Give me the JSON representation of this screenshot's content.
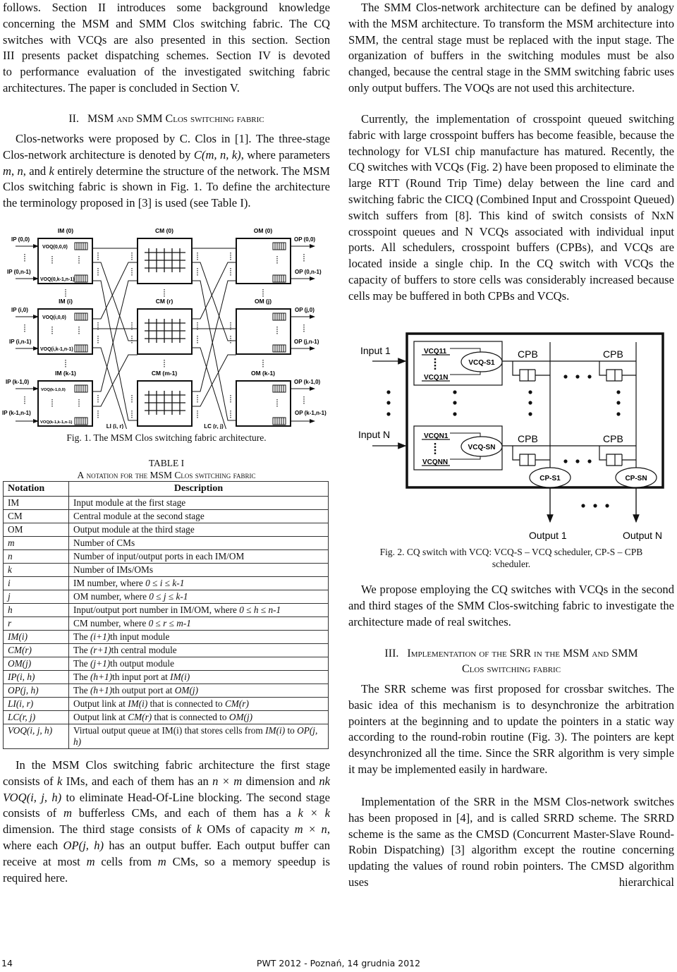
{
  "left_column": {
    "intro_paragraph": [
      "follows. Section II introduces some background knowledge",
      "concerning the MSM and SMM Clos switching fabric. The CQ",
      "switches with VCQs are also presented in this section. Section",
      "III presents packet dispatching schemes. Section IV is devoted",
      "to performance evaluation of the investigated switching fabric",
      "architectures. The paper is concluded in Section V."
    ],
    "section2_heading": {
      "number": "II.",
      "title_a": "MSM",
      "title_b": "and",
      "title_c": "SMM C",
      "title_d": "los switching fabric"
    },
    "section2_paragraph": {
      "t1": "Clos-networks were proposed by C. Clos in [1]. The three-stage Clos-network architecture is denoted by ",
      "i1": "C(m, n, k)",
      "t2": ", where parameters ",
      "i2": "m",
      "t3": ", ",
      "i3": "n",
      "t4": ", and ",
      "i4": "k",
      "t5": " entirely determine the structure of the network. The MSM Clos switching fabric is shown in Fig. 1. To define the architecture the terminology proposed in [3] is used (see Table I)."
    },
    "fig1": {
      "caption": "Fig. 1.  The MSM Clos switching fabric architecture.",
      "im_labels": [
        "IM (0)",
        "IM (i)",
        "IM (k-1)"
      ],
      "cm_labels": [
        "CM (0)",
        "CM (r)",
        "CM (m-1)"
      ],
      "om_labels": [
        "OM (0)",
        "OM (j)",
        "OM (k-1)"
      ],
      "ip_labels": [
        [
          "IP (0,0)",
          "IP (0,n-1)"
        ],
        [
          "IP (i,0)",
          "IP (i,n-1)"
        ],
        [
          "IP (k-1,0)",
          "IP (k-1,n-1)"
        ]
      ],
      "op_labels": [
        [
          "OP (0,0)",
          "OP (0,n-1)"
        ],
        [
          "OP (j,0)",
          "OP (j,n-1)"
        ],
        [
          "OP (k-1,0)",
          "OP (k-1,n-1)"
        ]
      ],
      "voq_labels": [
        [
          "VOQ(0,0,0)",
          "VOQ(0,k-1,n-1)"
        ],
        [
          "VOQ(i,0,0)",
          "VOQ(i,k-1,n-1)"
        ],
        [
          "VOQ(k-1,0,0)",
          "VOQ(k-1,k-1,n-1)"
        ]
      ],
      "link_labels": {
        "li": "LI (i, r)",
        "lc": "LC (r, j)"
      }
    },
    "table1": {
      "title": "TABLE I",
      "subtitle_a": "A",
      "subtitle_b": " notation for the ",
      "subtitle_c": "MSM C",
      "subtitle_d": "los switching fabric",
      "headers": [
        "Notation",
        "Description"
      ],
      "rows": [
        {
          "n": "IM",
          "n_italic": false,
          "d": "Input module at the first stage"
        },
        {
          "n": "CM",
          "n_italic": false,
          "d": "Central module at the second stage"
        },
        {
          "n": "OM",
          "n_italic": false,
          "d": "Output module at the third stage"
        },
        {
          "n": "m",
          "n_italic": true,
          "d": "Number of CMs"
        },
        {
          "n": "n",
          "n_italic": true,
          "d": "Number of input/output ports in each IM/OM"
        },
        {
          "n": "k",
          "n_italic": true,
          "d": "Number of IMs/OMs"
        },
        {
          "n": "i",
          "n_italic": true,
          "d": "IM number, where ",
          "d_i": "0 ≤ i ≤ k-1"
        },
        {
          "n": "j",
          "n_italic": true,
          "d": "OM number, where ",
          "d_i": "0 ≤ j ≤ k-1"
        },
        {
          "n": "h",
          "n_italic": true,
          "d": "Input/output port number in IM/OM, where ",
          "d_i": "0 ≤ h ≤ n-1"
        },
        {
          "n": "r",
          "n_italic": true,
          "d": "CM number, where ",
          "d_i": "0 ≤ r ≤ m-1"
        },
        {
          "n": "IM(i)",
          "n_italic": true,
          "d": "The ",
          "d_i": "(i+1)",
          "d2": "th input module"
        },
        {
          "n": "CM(r)",
          "n_italic": true,
          "d": "The ",
          "d_i": "(r+1)",
          "d2": "th central module"
        },
        {
          "n": "OM(j)",
          "n_italic": true,
          "d": "The ",
          "d_i": "(j+1)",
          "d2": "th output module"
        },
        {
          "n": "IP(i, h)",
          "n_italic": true,
          "d": "The ",
          "d_i": "(h+1)",
          "d2": "th input port at ",
          "d_i2": "IM(i)"
        },
        {
          "n": "OP(j, h)",
          "n_italic": true,
          "d": "The ",
          "d_i": "(h+1)",
          "d2": "th output port at ",
          "d_i2": "OM(j)"
        },
        {
          "n": "LI(i, r)",
          "n_italic": true,
          "d": "Output link at ",
          "d_i": "IM(i)",
          "d2": " that is connected to ",
          "d_i2": "CM(r)"
        },
        {
          "n": "LC(r, j)",
          "n_italic": true,
          "d": "Output link at ",
          "d_i": "CM(r)",
          "d2": " that is connected to ",
          "d_i2": "OM(j)"
        },
        {
          "n": "VOQ(i, j, h)",
          "n_italic": true,
          "d": "Virtual output queue at IM(i) that stores cells from ",
          "d_i": "IM(i)",
          "d2": " to ",
          "d_i2": "OP(j, h)"
        }
      ]
    },
    "msm_paragraph": {
      "t1": "In the MSM Clos switching fabric architecture the first stage consists of ",
      "i1": "k",
      "t2": " IMs, and each of them has an ",
      "i2": "n × m",
      "t3": " dimension and ",
      "i3": "nk VOQ(i, j, h)",
      "t4": " to eliminate Head-Of-Line blocking. The second stage consists of ",
      "i4": "m",
      "t5": " bufferless CMs, and each of them has a ",
      "i5": "k × k",
      "t6": " dimension. The third stage consists of ",
      "i6": "k",
      "t7": " OMs of capacity ",
      "i7": "m × n",
      "t8": ", where each ",
      "i8": "OP(j, h)",
      "t9": " has an output buffer. Each output buffer can receive at most ",
      "i9": "m",
      "t10": " cells from ",
      "i10": "m",
      "t11": " CMs, so a memory speedup is required here."
    }
  },
  "right_column": {
    "smm_paragraph": "The SMM Clos-network architecture can be defined by analogy with the MSM architecture. To transform the MSM architecture into SMM, the central stage must be replaced with the input stage. The organization of buffers in the switching modules must be also changed, because the central stage in the SMM switching fabric uses only output buffers. The VOQs are not used this architecture.",
    "cq_paragraph": "Currently, the implementation of crosspoint queued switching fabric with large crosspoint buffers has become feasible, because the technology for VLSI chip manufacture has matured. Recently, the CQ switches with VCQs (Fig. 2) have been proposed to eliminate the large RTT (Round Trip Time) delay between the line card and switching fabric the CICQ (Combined Input and Crosspoint Queued) switch suffers from [8]. This kind of switch consists of NxN crosspoint queues and N VCQs associated with individual input ports. All schedulers, crosspoint buffers (CPBs), and VCQs are located inside a single chip. In the CQ switch with VCQs the capacity of buffers to store cells was considerably increased because cells may be buffered in both CPBs and VCQs.",
    "fig2": {
      "inputs": [
        "Input 1",
        "Input N"
      ],
      "vcq_top": [
        "VCQ11",
        "VCQ1N"
      ],
      "vcq_bottom": [
        "VCQN1",
        "VCQNN"
      ],
      "vcq_schedulers": [
        "VCQ-S1",
        "VCQ-SN"
      ],
      "cpb_label": "CPB",
      "cp_schedulers": [
        "CP-S1",
        "CP-SN"
      ],
      "outputs": [
        "Output 1",
        "Output N"
      ],
      "caption_line1": "Fig. 2.  CQ switch with VCQ: VCQ-S – VCQ scheduler, CP-S – CPB",
      "caption_line2": "scheduler."
    },
    "propose_paragraph": "We propose employing the CQ switches with VCQs in the second and third stages of the SMM Clos-switching fabric to investigate the architecture made of real switches.",
    "section3_heading": {
      "number": "III.",
      "line1_a": "I",
      "line1_b": "mplementation of the ",
      "line1_c": "SRR",
      "line1_d": " in the ",
      "line1_e": "MSM",
      "line1_f": " and ",
      "line1_g": "SMM",
      "line2_a": "C",
      "line2_b": "los switching fabric"
    },
    "srr_paragraph": "The SRR scheme was first proposed for crossbar switches. The basic idea of this mechanism is to desynchronize the arbitration pointers at the beginning and to update the pointers in a static way according to the round-robin routine (Fig. 3). The pointers are kept desynchronized all the time. Since the SRR algorithm is very simple it may be implemented easily in hardware.",
    "srrd_paragraph": "Implementation of the SRR in the MSM Clos-network switches has been proposed in [4], and is called SRRD scheme. The SRRD scheme is the same as the CMSD (Concurrent Master-Slave Round-Robin Dispatching) [3] algorithm except the routine concerning updating the values of round robin pointers. The CMSD algorithm uses hierarchical"
  },
  "footer": {
    "page_number": "14",
    "conference": "PWT 2012 - Poznań, 14 grudnia 2012"
  }
}
